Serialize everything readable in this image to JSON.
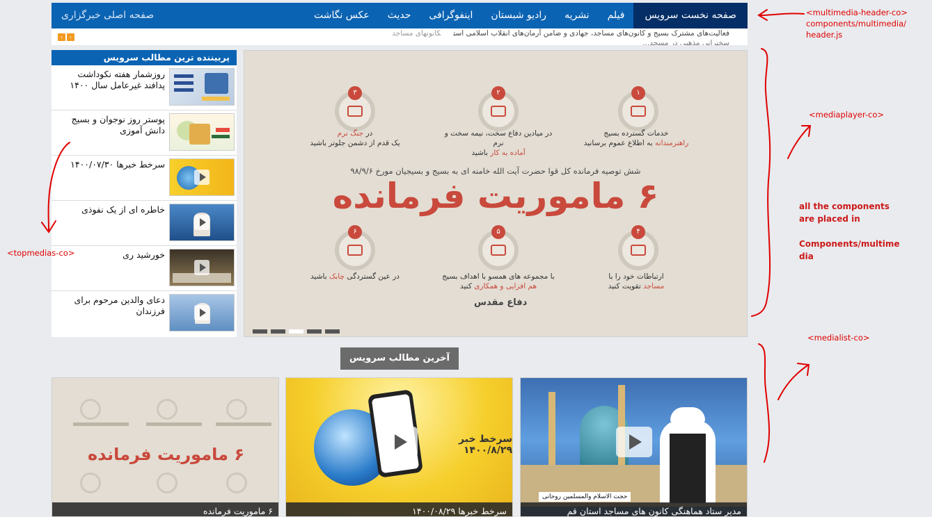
{
  "header": {
    "nav": [
      "صفحه نخست سرویس",
      "فیلم",
      "نشریه",
      "رادیو شبستان",
      "اینفوگرافی",
      "حدیث",
      "عکس نگاشت"
    ],
    "home_link": "صفحه اصلی خبرگزاری"
  },
  "ticker": {
    "line1": "فعالیت‌های مشترک بسیج و کانون‌های مساجد، جهادی و ضامن آرمان‌های انقلاب اسلامی است",
    "source": "کانونهای مساجد",
    "line2": "...سخنرانی مذهبی در مسجد"
  },
  "topmedias": {
    "heading": "پربیننده ترین مطالب سرویس",
    "items": [
      {
        "title": "روزشمار هفته نکوداشت پدافند غیرعامل سال ۱۴۰۰"
      },
      {
        "title": "پوستر روز نوجوان و بسیج دانش آموزی"
      },
      {
        "title": "سرخط خبرها ۱۴۰۰/۰۷/۳۰"
      },
      {
        "title": "خاطره ای از یک نفوذی"
      },
      {
        "title": "خورشید ری"
      },
      {
        "title": "دعای والدین مرحوم برای فرزندان"
      }
    ]
  },
  "player": {
    "items": [
      {
        "n": "۱",
        "text": "خدمات گسترده بسیج",
        "red": "راهنرمندانه",
        "text2": "به اطلاع عموم برسانید"
      },
      {
        "n": "۲",
        "text": "در میادین دفاع سخت، نیمه سخت و نرم",
        "red": "آماده به کار",
        "text2": "باشید"
      },
      {
        "n": "۳",
        "text": "در",
        "red": "جنگ نرم",
        "text2": "یک قدم از دشمن جلوتر باشید"
      },
      {
        "n": "۴",
        "text": "ارتباطات خود را با",
        "red": "مساجد",
        "text2": "تقویت کنید"
      },
      {
        "n": "۵",
        "text": "با مجموعه های همسو با اهداف بسیج",
        "red": "هم افزایی و همکاری",
        "text2": "کنید"
      },
      {
        "n": "۶",
        "text": "در عین گستردگی",
        "red": "چابک",
        "text2": "باشید"
      }
    ],
    "heading": "شش توصیه فرمانده کل قوا حضرت آیت الله خامنه ای به بسیج و بسیجیان مورخ ۹۸/۹/۶",
    "big_title": "۶ ماموریت فرمانده",
    "logo": "دفاع مقدس",
    "slides": 5,
    "active_slide": 3
  },
  "latest_button": "آخرین مطالب سرویس",
  "medialist": [
    {
      "caption": "مدیر ستاد هماهنگی کانون های مساجد استان قم",
      "overlay": "حجت الاسلام والمسلمین روحانی"
    },
    {
      "caption": "سرخط خبرها ۱۴۰۰/۰۸/۲۹",
      "overlay": "سرخط خبر ۱۴۰۰/۸/۲۹"
    },
    {
      "caption": "۶ ماموریت فرمانده"
    }
  ],
  "annotations": {
    "header": "<multimedia-header-co>\ncomponents/multimedia/\nheader.js",
    "player": "<mediaplayer-co>",
    "note": "all the components\nare placed in\n\nComponents/multime\ndia",
    "topmedias": "<topmedias-co>",
    "medialist": "<medialist-co>"
  }
}
